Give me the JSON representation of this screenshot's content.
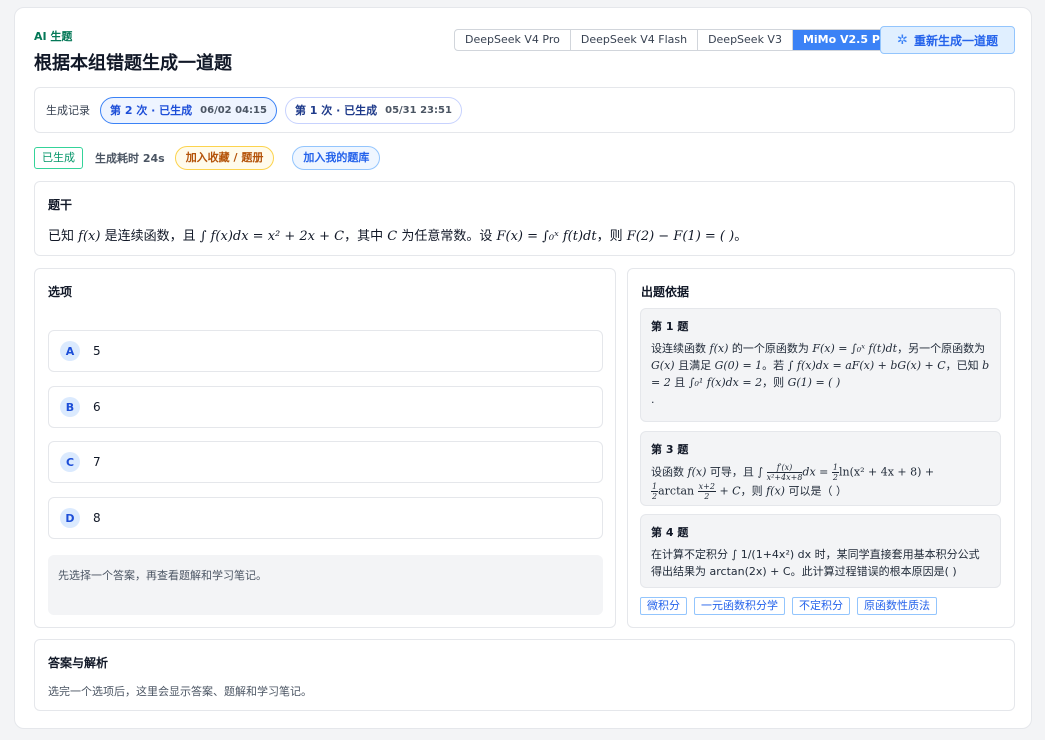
{
  "header": {
    "tag": "AI 生题",
    "title": "根据本组错题生成一道题",
    "models": [
      "DeepSeek V4 Pro",
      "DeepSeek V4 Flash",
      "DeepSeek V3",
      "MiMo V2.5 Pro"
    ],
    "active_model": "MiMo V2.5 Pro",
    "regenerate_label": "重新生成一道题"
  },
  "history": {
    "label": "生成记录",
    "items": [
      {
        "label": "第 2 次 · 已生成",
        "time": "06/02 04:15",
        "active": true
      },
      {
        "label": "第 1 次 · 已生成",
        "time": "05/31 23:51",
        "active": false
      }
    ]
  },
  "status": {
    "badge": "已生成",
    "duration": "生成耗时 24s",
    "favorite_label": "加入收藏 / 题册",
    "library_label": "加入我的题库"
  },
  "stem": {
    "title": "题干",
    "text_parts": [
      "已知 ",
      "f(x)",
      " 是连续函数，且 ",
      "∫ f(x)dx = x² + 2x + C",
      "，其中 ",
      "C",
      " 为任意常数。设 ",
      "F(x) = ∫₀ˣ f(t)dt",
      "，则 ",
      "F(2) − F(1) = (   )",
      "。"
    ]
  },
  "options": {
    "title": "选项",
    "items": [
      {
        "letter": "A",
        "text": "5"
      },
      {
        "letter": "B",
        "text": "6"
      },
      {
        "letter": "C",
        "text": "7"
      },
      {
        "letter": "D",
        "text": "8"
      }
    ],
    "hint": "先选择一个答案，再查看题解和学习笔记。"
  },
  "basis": {
    "title": "出题依据",
    "questions": [
      {
        "title": "第 1 题"
      },
      {
        "title": "第 3 题"
      },
      {
        "title": "第 4 题",
        "body": "在计算不定积分 ∫ 1/(1+4x²) dx 时，某同学直接套用基本积分公式得出结果为 arctan(2x) + C。此计算过程错误的根本原因是( )"
      }
    ],
    "q1": {
      "t1": "设连续函数 ",
      "m1": "f(x)",
      "t2": " 的一个原函数为 ",
      "m2": "F(x) = ∫₀ˣ f(t)dt",
      "t3": "，另一个原函数为 ",
      "m3": "G(x)",
      "t4": " 且满足 ",
      "m4": "G(0) = 1",
      "t5": "。若 ",
      "m5": "∫ f(x)dx = aF(x) + bG(x) + C",
      "t6": "，已知 ",
      "m6": "b = 2",
      "t7": " 且 ",
      "m7": "∫₀¹ f(x)dx = 2",
      "t8": "，则 ",
      "m8": "G(1) = (    )",
      "t9": "."
    },
    "q3": {
      "t1": "设函数 ",
      "m1": "f(x)",
      "t2": " 可导，且 ∫ ",
      "frac1_num": "f′(x)",
      "frac1_den": "x²+4x+8",
      "m2": "dx = ",
      "frac2_num": "1",
      "frac2_den": "2",
      "m3": "ln(x² + 4x + 8) + ",
      "frac3_num": "1",
      "frac3_den": "2",
      "m4": "arctan ",
      "frac4_num": "x+2",
      "frac4_den": "2",
      "m5": " + C",
      "t3": "，则 ",
      "m6": "f(x)",
      "t4": " 可以是（ ）"
    },
    "tags": [
      "微积分",
      "一元函数积分学",
      "不定积分",
      "原函数性质法"
    ]
  },
  "answer": {
    "title": "答案与解析",
    "text": "选完一个选项后，这里会显示答案、题解和学习笔记。"
  },
  "colors": {
    "accent": "#3b82f6",
    "success": "#059669",
    "warning": "#b45309"
  }
}
